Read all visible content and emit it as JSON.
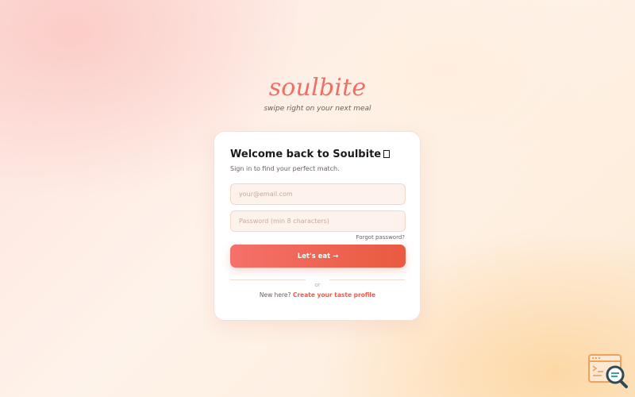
{
  "brand": {
    "logo": "soulbite",
    "tagline": "swipe right on your next meal"
  },
  "login": {
    "title": "Welcome back to Soulbite",
    "subtitle": "Sign in to find your perfect match.",
    "email_placeholder": "your@email.com",
    "password_placeholder": "Password (min 8 characters)",
    "forgot_label": "Forgot password?",
    "submit_label": "Let's eat →",
    "divider_label": "or",
    "signup_prompt": "New here?",
    "signup_link": "Create your taste profile"
  },
  "colors": {
    "accent": "#ef6f67",
    "button_start": "#f4716a",
    "button_end": "#e95a3f",
    "link": "#ef5a4c"
  },
  "icons": {
    "corner_badge": "search-code-icon"
  }
}
